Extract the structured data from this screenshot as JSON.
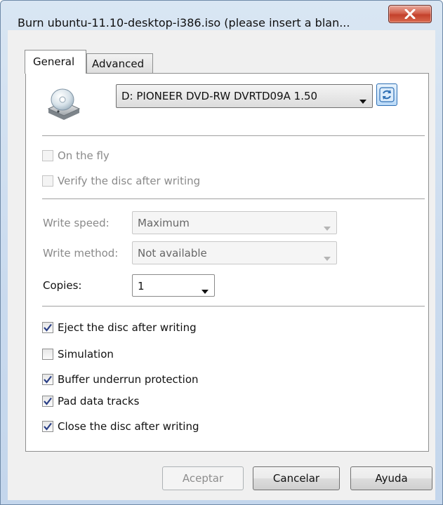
{
  "window": {
    "title": "Burn ubuntu-11.10-desktop-i386.iso (please insert a blan...",
    "close_icon": "x-icon"
  },
  "tabs": [
    {
      "label": "General",
      "selected": true
    },
    {
      "label": "Advanced",
      "selected": false
    }
  ],
  "general": {
    "drive_icon": "disc-drive-icon",
    "drive_select": {
      "value": "D: PIONEER DVD-RW  DVRTD09A 1.50"
    },
    "refresh_icon": "refresh-icon",
    "on_the_fly": {
      "label": "On the fly",
      "checked": false,
      "enabled": false
    },
    "verify": {
      "label": "Verify the disc after writing",
      "checked": false,
      "enabled": false
    },
    "write_speed": {
      "label": "Write speed:",
      "value": "Maximum",
      "enabled": false
    },
    "write_method": {
      "label": "Write method:",
      "value": "Not available",
      "enabled": false
    },
    "copies": {
      "label": "Copies:",
      "value": "1",
      "enabled": true
    },
    "options": [
      {
        "label": "Eject the disc after writing",
        "checked": true
      },
      {
        "label": "Simulation",
        "checked": false
      },
      {
        "label": "Buffer underrun protection",
        "checked": true
      },
      {
        "label": "Pad data tracks",
        "checked": true
      },
      {
        "label": "Close the disc after writing",
        "checked": true
      }
    ]
  },
  "buttons": {
    "ok": {
      "label": "Aceptar",
      "enabled": false
    },
    "cancel": {
      "label": "Cancelar",
      "enabled": true
    },
    "help": {
      "label": "Ayuda",
      "enabled": true
    }
  },
  "colors": {
    "check_mark": "#2a3f86",
    "close_button": "#c3412c",
    "refresh_accent": "#2e6fb4"
  }
}
